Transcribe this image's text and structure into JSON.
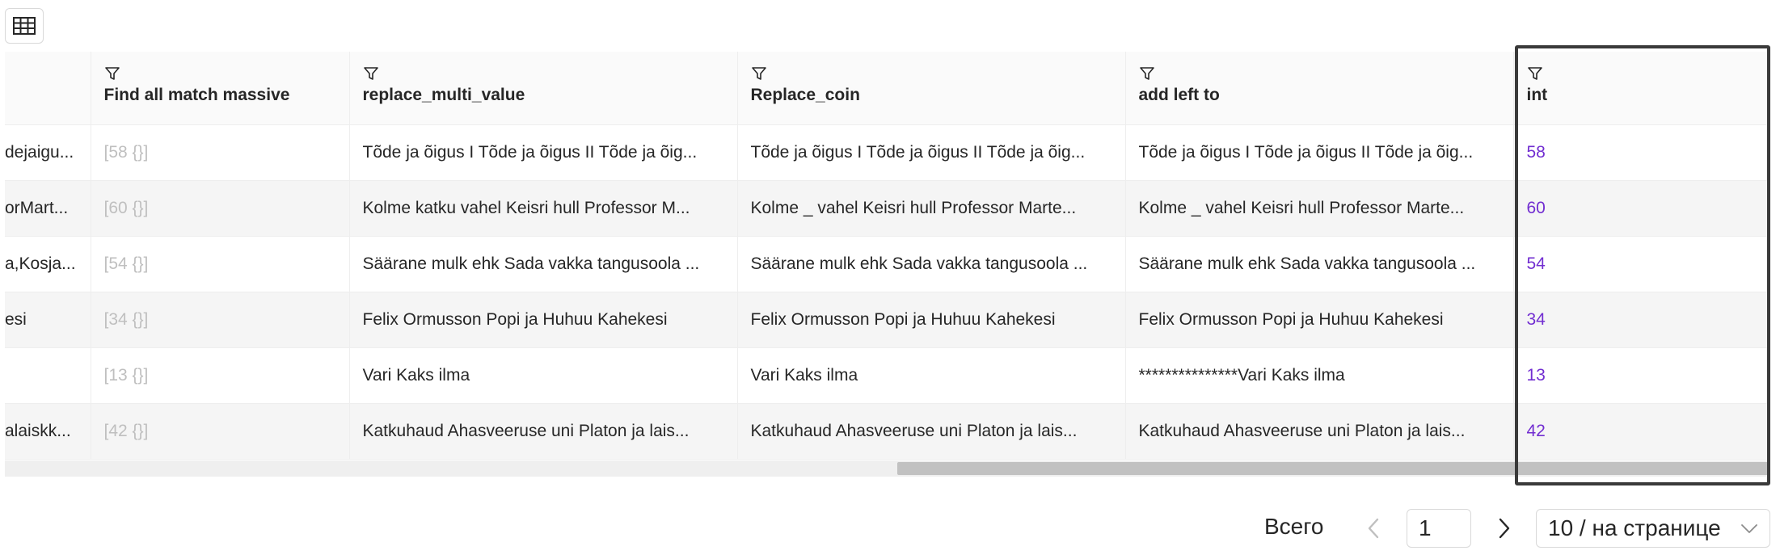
{
  "toolbar": {
    "view_icon": "table-icon"
  },
  "table": {
    "columns": [
      {
        "label": ""
      },
      {
        "label": "Find all match massive"
      },
      {
        "label": "replace_multi_value"
      },
      {
        "label": "Replace_coin"
      },
      {
        "label": "add left to"
      },
      {
        "label": "int"
      }
    ],
    "rows": [
      [
        "dejaigu...",
        "[58 {}]",
        "Tõde ja õigus I Tõde ja õigus II Tõde ja õig...",
        "Tõde ja õigus I Tõde ja õigus II Tõde ja õig...",
        "Tõde ja õigus I Tõde ja õigus II Tõde ja õig...",
        "58"
      ],
      [
        "orMart...",
        "[60 {}]",
        "Kolme katku vahel Keisri hull Professor M...",
        "Kolme _ vahel Keisri hull Professor Marte...",
        "Kolme _ vahel Keisri hull Professor Marte...",
        "60"
      ],
      [
        "a,Kosja...",
        "[54 {}]",
        "Säärane mulk ehk Sada vakka tangusoola ...",
        "Säärane mulk ehk Sada vakka tangusoola ...",
        "Säärane mulk ehk Sada vakka tangusoola ...",
        "54"
      ],
      [
        "esi",
        "[34 {}]",
        "Felix Ormusson Popi ja Huhuu Kahekesi",
        "Felix Ormusson Popi ja Huhuu Kahekesi",
        "Felix Ormusson Popi ja Huhuu Kahekesi",
        "34"
      ],
      [
        "",
        "[13 {}]",
        "Vari Kaks ilma",
        "Vari Kaks ilma",
        "***************Vari Kaks ilma",
        "13"
      ],
      [
        "alaiskk...",
        "[42 {}]",
        "Katkuhaud Ahasveeruse uni Platon ja lais...",
        "Katkuhaud Ahasveeruse uni Platon ja lais...",
        "Katkuhaud Ahasveeruse uni Platon ja lais...",
        "42"
      ]
    ]
  },
  "pagination": {
    "total_label": "Всего",
    "current_page": "1",
    "page_size": "10 / на странице"
  },
  "colors": {
    "int_value": "#722ed1",
    "muted_value": "#bfbfbf"
  }
}
